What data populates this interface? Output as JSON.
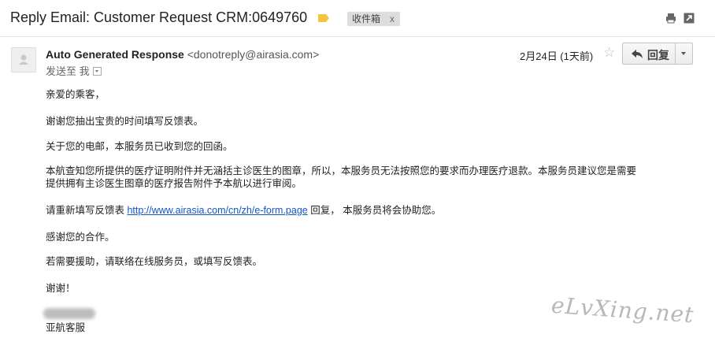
{
  "email": {
    "subject": "Reply Email: Customer Request CRM:0649760",
    "label_chip": "收件箱",
    "label_chip_close": "x",
    "sender_name": "Auto Generated Response",
    "sender_email": "<donotreply@airasia.com>",
    "to_line": "发送至 我",
    "date": "2月24日 (1天前)",
    "reply_label": "回复",
    "star_glyph": "☆",
    "body": {
      "greeting": "亲爱的乘客，",
      "p1": "谢谢您抽出宝贵的时间填写反馈表。",
      "p2": "关于您的电邮，本服务员已收到您的回函。",
      "p3_line1": "本航查知您所提供的医疗证明附件并无涵括主诊医生的图章，所以，本服务员无法按照您的要求而办理医疗退款。本服务员建议您是需要",
      "p3_line2": "提供拥有主诊医生图章的医疗报告附件予本航以进行审阅。",
      "p4_before": "请重新填写反馈表 ",
      "p4_link": "http://www.airasia.com/cn/zh/e-form.page",
      "p4_after": " 回复， 本服务员将会协助您。",
      "p5": "感谢您的合作。",
      "p6": "若需要援助，请联络在线服务员，或填写反馈表。",
      "p7": "谢谢！",
      "signature": "亚航客服"
    }
  },
  "watermark": "eLvXing.net",
  "colors": {
    "link": "#1155cc",
    "label_tag": "#f4c542",
    "chip_bg": "#dddddd"
  },
  "icons": [
    "label-tag-icon",
    "print-icon",
    "new-window-icon",
    "avatar-icon",
    "star-icon",
    "reply-arrow-icon",
    "dropdown-arrow-icon"
  ]
}
